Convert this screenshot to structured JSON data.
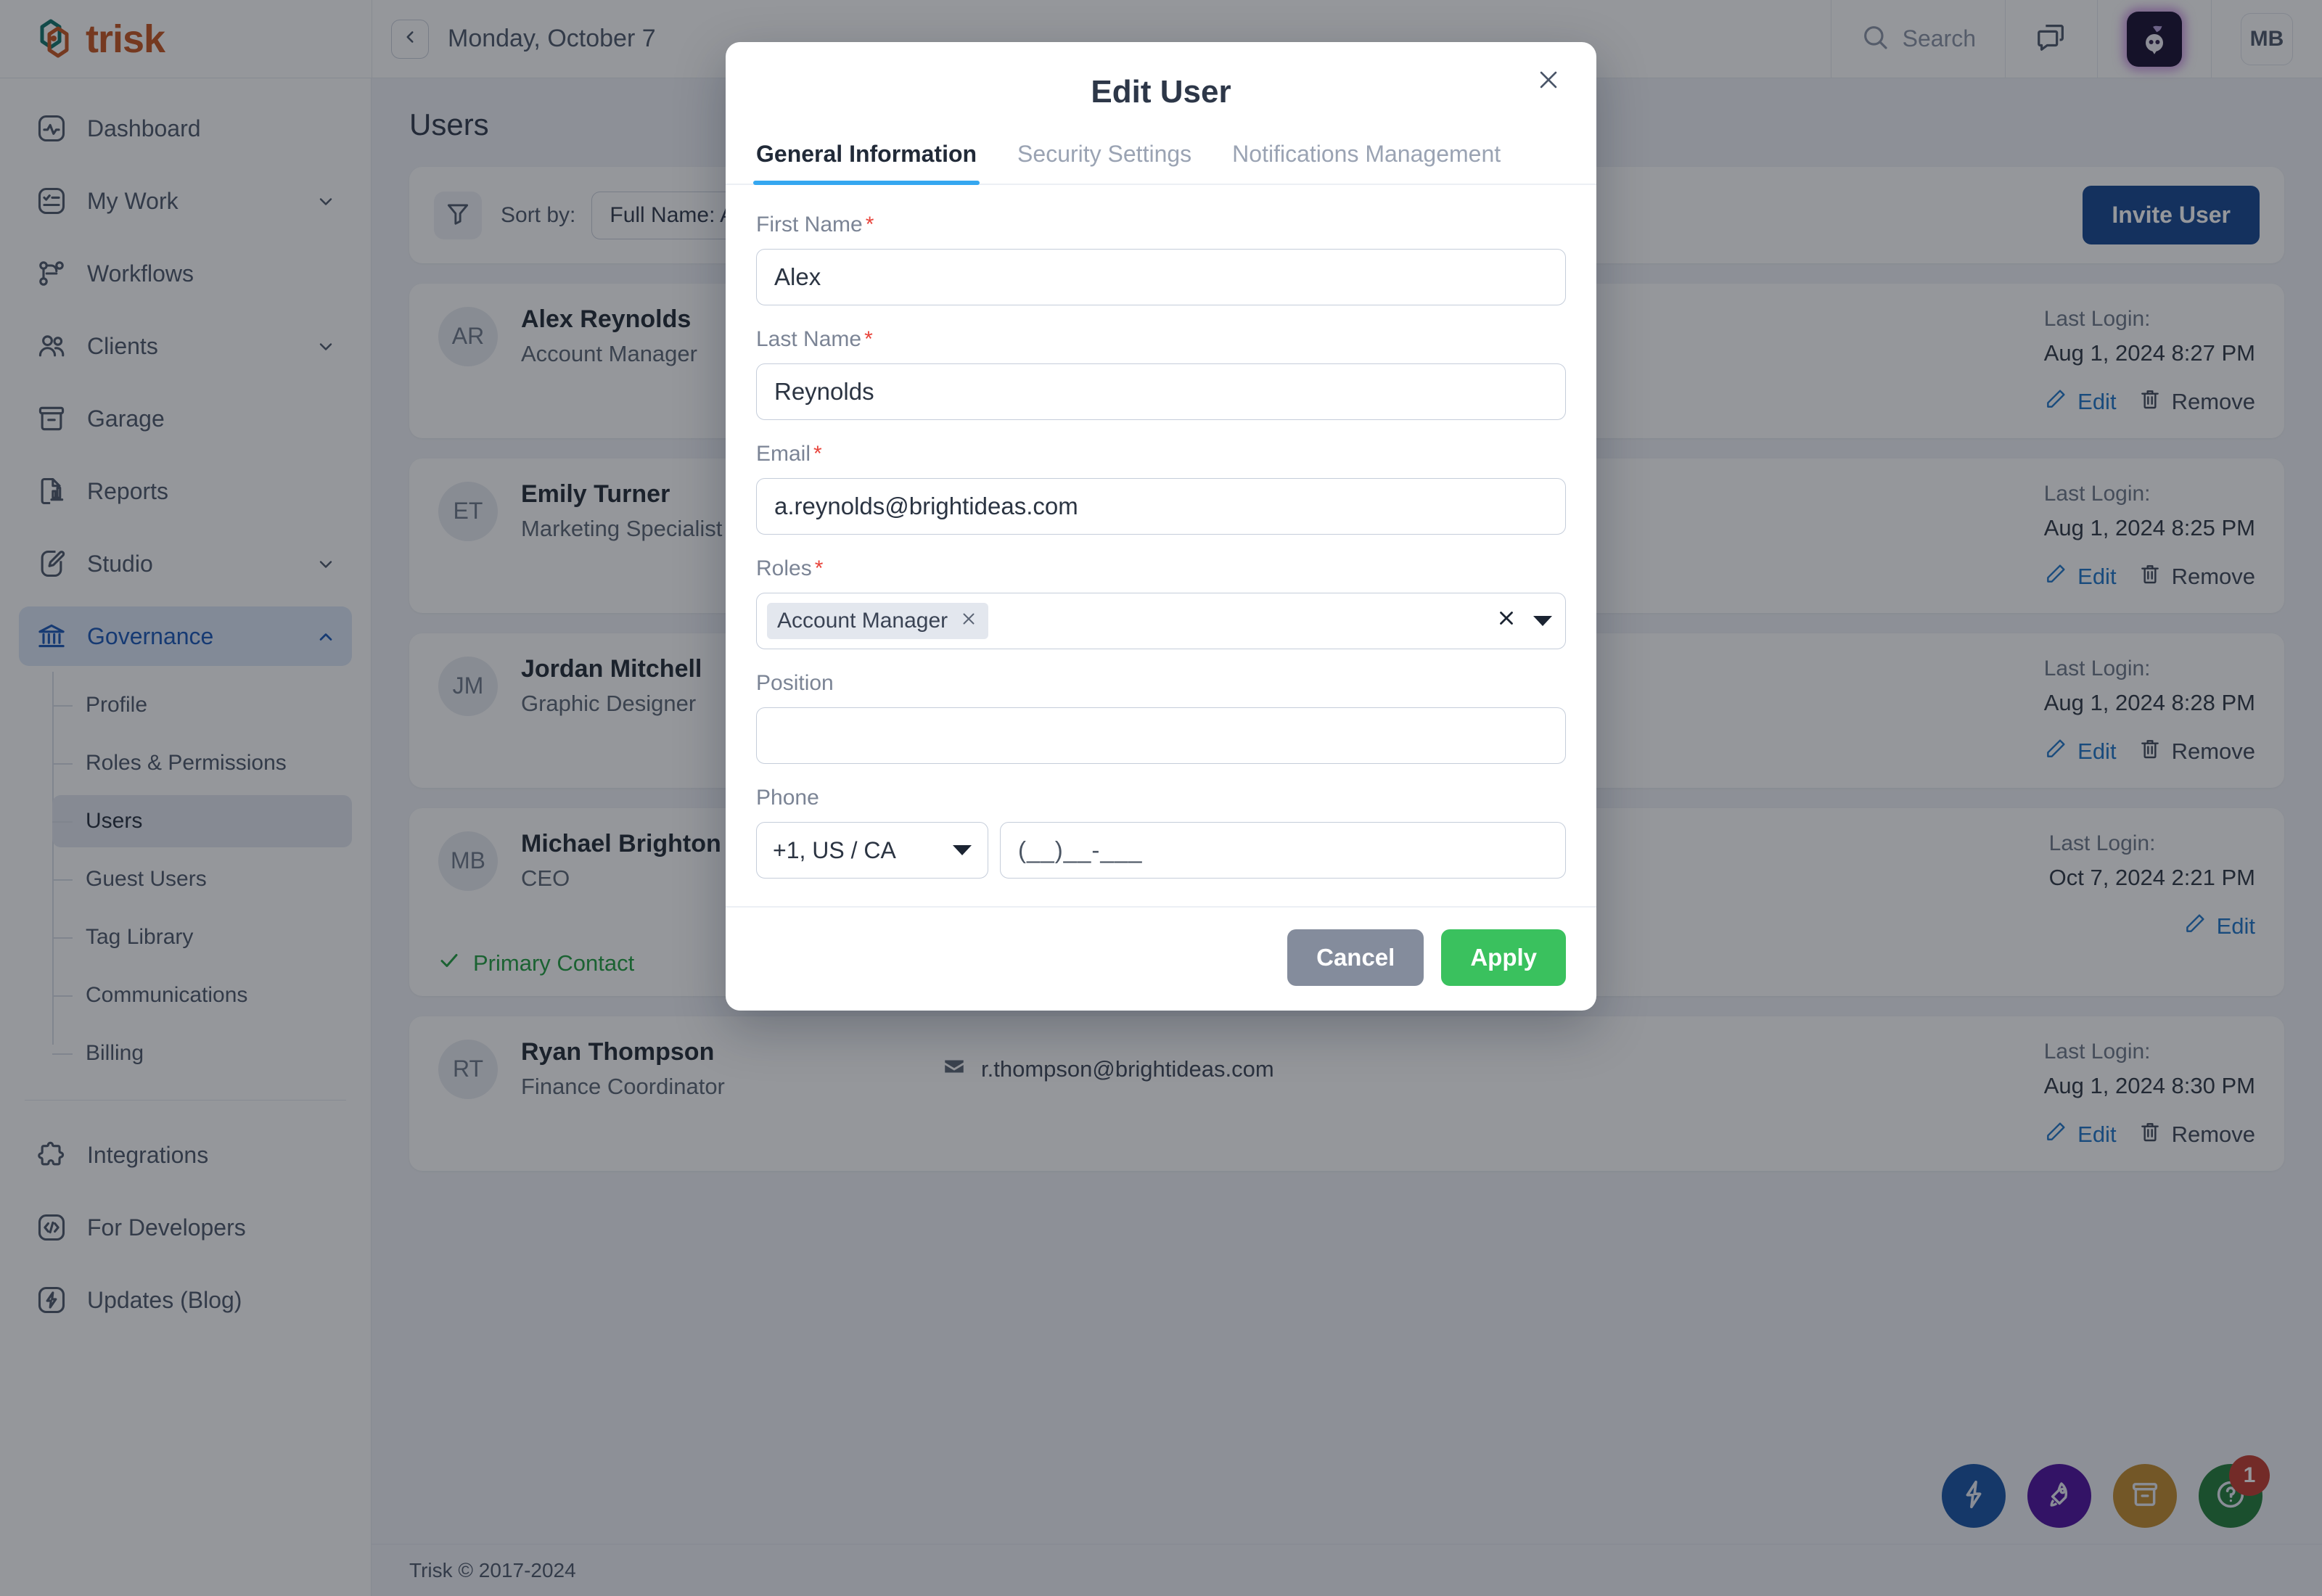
{
  "brand": {
    "name": "trisk",
    "accent": "#c5521c",
    "mark_teal": "#0d7268"
  },
  "header": {
    "date_label": "Monday, October 7",
    "back_icon": "chevron-left-icon",
    "search_placeholder": "Search",
    "search_icon": "search-icon",
    "messages_icon": "chat-bubbles-icon",
    "assistant_icon": "ai-bot-icon",
    "avatar_initials": "MB"
  },
  "sidebar": {
    "items": [
      {
        "label": "Dashboard",
        "icon": "activity-icon",
        "expandable": false,
        "active": false
      },
      {
        "label": "My Work",
        "icon": "checklist-icon",
        "expandable": true,
        "active": false
      },
      {
        "label": "Workflows",
        "icon": "workflow-icon",
        "expandable": false,
        "active": false
      },
      {
        "label": "Clients",
        "icon": "people-icon",
        "expandable": true,
        "active": false
      },
      {
        "label": "Garage",
        "icon": "archive-icon",
        "expandable": false,
        "active": false
      },
      {
        "label": "Reports",
        "icon": "report-chart-icon",
        "expandable": false,
        "active": false
      },
      {
        "label": "Studio",
        "icon": "brush-icon",
        "expandable": true,
        "active": false
      },
      {
        "label": "Governance",
        "icon": "bank-icon",
        "expandable": true,
        "active": true,
        "expanded": true
      }
    ],
    "governance_children": [
      {
        "label": "Profile",
        "active": false
      },
      {
        "label": "Roles & Permissions",
        "active": false
      },
      {
        "label": "Users",
        "active": true
      },
      {
        "label": "Guest Users",
        "active": false
      },
      {
        "label": "Tag Library",
        "active": false
      },
      {
        "label": "Communications",
        "active": false
      },
      {
        "label": "Billing",
        "active": false
      }
    ],
    "bottom_items": [
      {
        "label": "Integrations",
        "icon": "puzzle-icon"
      },
      {
        "label": "For Developers",
        "icon": "code-icon"
      },
      {
        "label": "Updates (Blog)",
        "icon": "bolt-square-icon"
      }
    ]
  },
  "page": {
    "title": "Users",
    "filter_icon": "funnel-icon",
    "sort_label": "Sort by:",
    "sort_value": "Full Name: A-Z",
    "invite_label": "Invite User",
    "invite_color": "#12438f",
    "footer": "Trisk © 2017-2024"
  },
  "users": [
    {
      "initials": "AR",
      "name": "Alex Reynolds",
      "role": "Account Manager",
      "email": "",
      "login_label": "Last Login:",
      "login_value": "Aug 1, 2024 8:27 PM",
      "edit_label": "Edit",
      "remove_label": "Remove",
      "primary_contact": false,
      "primary_label": ""
    },
    {
      "initials": "ET",
      "name": "Emily Turner",
      "role": "Marketing Specialist",
      "email": "",
      "login_label": "Last Login:",
      "login_value": "Aug 1, 2024 8:25 PM",
      "edit_label": "Edit",
      "remove_label": "Remove",
      "primary_contact": false,
      "primary_label": ""
    },
    {
      "initials": "JM",
      "name": "Jordan Mitchell",
      "role": "Graphic Designer",
      "email": "",
      "login_label": "Last Login:",
      "login_value": "Aug 1, 2024 8:28 PM",
      "edit_label": "Edit",
      "remove_label": "Remove",
      "primary_contact": false,
      "primary_label": ""
    },
    {
      "initials": "MB",
      "name": "Michael Brighton",
      "role": "CEO",
      "email": "",
      "login_label": "Last Login:",
      "login_value": "Oct 7, 2024 2:21 PM",
      "edit_label": "Edit",
      "remove_label": "",
      "primary_contact": true,
      "primary_label": "Primary Contact"
    },
    {
      "initials": "RT",
      "name": "Ryan Thompson",
      "role": "Finance Coordinator",
      "email": "r.thompson@brightideas.com",
      "login_label": "Last Login:",
      "login_value": "Aug 1, 2024 8:30 PM",
      "edit_label": "Edit",
      "remove_label": "Remove",
      "primary_contact": false,
      "primary_label": ""
    }
  ],
  "fabs": [
    {
      "icon": "bolt-icon",
      "color": "#1450a3",
      "badge": ""
    },
    {
      "icon": "rocket-icon",
      "color": "#4b0c9e",
      "badge": ""
    },
    {
      "icon": "archive-icon",
      "color": "#c08a2a",
      "badge": ""
    },
    {
      "icon": "help-circle-icon",
      "color": "#1f7a36",
      "badge": "1"
    }
  ],
  "modal": {
    "title": "Edit User",
    "close_icon": "close-icon",
    "tabs": [
      {
        "label": "General Information",
        "active": true
      },
      {
        "label": "Security Settings",
        "active": false
      },
      {
        "label": "Notifications Management",
        "active": false
      }
    ],
    "active_tab_color": "#35a7f0",
    "fields": {
      "first_name": {
        "label": "First Name",
        "required": true,
        "value": "Alex"
      },
      "last_name": {
        "label": "Last Name",
        "required": true,
        "value": "Reynolds"
      },
      "email": {
        "label": "Email",
        "required": true,
        "value": "a.reynolds@brightideas.com"
      },
      "roles": {
        "label": "Roles",
        "required": true,
        "chips": [
          "Account Manager"
        ],
        "clear_icon": "clear-x-icon",
        "dropdown_icon": "caret-down-icon"
      },
      "position": {
        "label": "Position",
        "required": false,
        "value": ""
      },
      "phone": {
        "label": "Phone",
        "required": false,
        "country_code": "+1, US / CA",
        "placeholder": "(__)__-___"
      }
    },
    "buttons": {
      "cancel": {
        "label": "Cancel",
        "color": "#848c9c"
      },
      "apply": {
        "label": "Apply",
        "color": "#3ac15e"
      }
    }
  }
}
